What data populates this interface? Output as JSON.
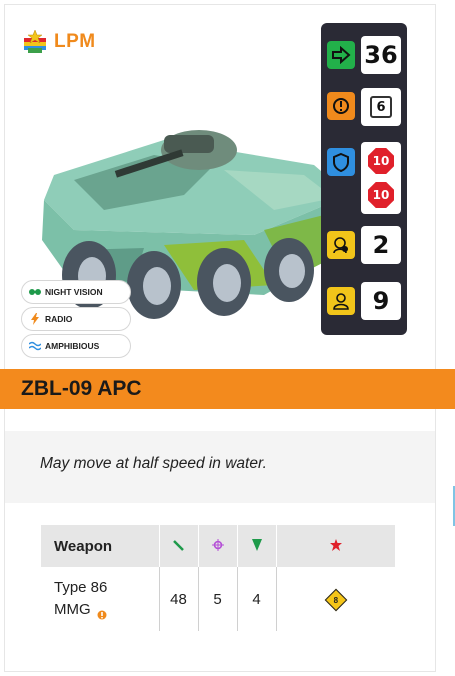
{
  "faction": {
    "label": "LPM",
    "icon": "faction-flag-icon"
  },
  "stats": {
    "movement": {
      "icon": "arrow-right-icon",
      "value": "36",
      "color": "#22b04a"
    },
    "spot": {
      "icon": "alert-gear-icon",
      "value": "6",
      "color": "#f08a1c"
    },
    "armor": {
      "icon": "shield-icon",
      "values": [
        "10",
        "10"
      ],
      "color": "#2f8fe0"
    },
    "crew": {
      "icon": "crew-helmet-icon",
      "value": "2",
      "color": "#f2c51a"
    },
    "passengers": {
      "icon": "person-icon",
      "value": "9",
      "color": "#f2c51a"
    }
  },
  "traits": [
    {
      "icon": "night-vision-icon",
      "label": "NIGHT VISION"
    },
    {
      "icon": "lightning-icon",
      "label": "RADIO"
    },
    {
      "icon": "waves-icon",
      "label": "AMPHIBIOUS"
    }
  ],
  "unit_name": "ZBL-09 APC",
  "description": "May move at half speed in water.",
  "weapons_table": {
    "header": "Weapon",
    "column_icons": [
      "range-icon",
      "accuracy-icon",
      "penetration-icon",
      "special-icon"
    ],
    "rows": [
      {
        "name": "Type 86",
        "name_line2": "MMG",
        "range": "48",
        "accuracy": "5",
        "penetration": "4",
        "special": "8"
      }
    ]
  },
  "colors": {
    "accent": "#f38a1d",
    "stat_panel": "#2a2a35"
  }
}
